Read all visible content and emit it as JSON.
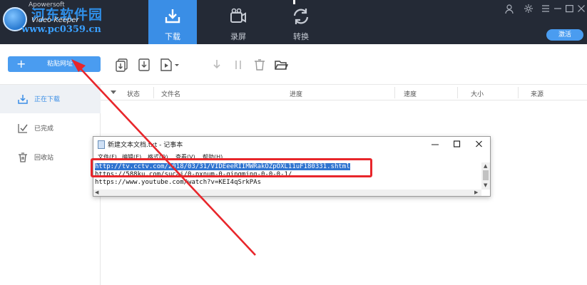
{
  "app": {
    "watermark_name": "河东软件园",
    "subtitle": "Video Keeper",
    "watermark_url": "www.pc0359.cn",
    "small_name": "Apowersoft"
  },
  "nav": {
    "tabs": [
      {
        "label": "下载",
        "icon": "download-icon",
        "active": true
      },
      {
        "label": "录屏",
        "icon": "camera-icon",
        "active": false
      },
      {
        "label": "转换",
        "icon": "convert-icon",
        "active": false
      }
    ],
    "login_label": "激活",
    "controls": [
      "user-icon",
      "settings-icon",
      "menu-icon",
      "minimize-icon",
      "maximize-icon",
      "close-icon"
    ]
  },
  "toolbar": {
    "paste_label": "粘贴网址",
    "paste_icon": "+"
  },
  "sidebar": {
    "items": [
      {
        "label": "正在下载",
        "icon": "download-icon",
        "active": true
      },
      {
        "label": "已完成",
        "icon": "check-icon",
        "active": false
      },
      {
        "label": "回收站",
        "icon": "trash-icon",
        "active": false
      }
    ]
  },
  "table": {
    "columns": [
      "状态",
      "文件名",
      "进度",
      "速度",
      "大小",
      "来源"
    ]
  },
  "notepad": {
    "title": "新建文本文档.txt - 记事本",
    "menu": [
      "文件(F)",
      "编辑(E)",
      "格式(O)",
      "查看(V)",
      "帮助(H)"
    ],
    "lines": [
      "http://tv.cctv.com/2018/03/31/VIDEeeRIIMWRakOZpOXL11uF180331.shtml",
      "https://588ku.com/sucai/0-pxnum-0-qingming-0-0-0-1/",
      "https://www.youtube.com/watch?v=KEI4qSrkPAs"
    ]
  },
  "colors": {
    "accent": "#3a8ee6",
    "topbar": "#242a36",
    "highlight": "#e8262b"
  }
}
